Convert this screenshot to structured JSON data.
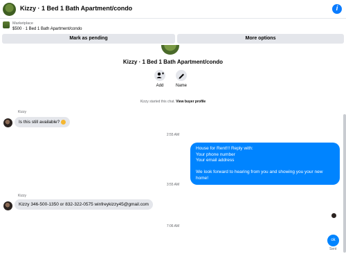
{
  "header": {
    "title": "Kizzy · 1 Bed 1 Bath Apartment/condo",
    "info_icon": "info-icon"
  },
  "marketplace": {
    "label": "Marketplace",
    "price_title": "$500 · 1 Bed 1 Bath Apartment/condo",
    "mark_pending": "Mark as pending",
    "more_options": "More options"
  },
  "chat": {
    "title": "Kizzy · 1 Bed 1 Bath Apartment/condo",
    "actions": {
      "add": "Add",
      "name": "Name"
    },
    "started_text": "Kizzy started this chat.",
    "view_profile": "View buyer profile",
    "sender": "Kizzy",
    "messages": {
      "m1": "Is this still available?",
      "t1": "2:55 AM",
      "out1": [
        "House for Rent!!! Reply with:",
        "Your phone number",
        "Your email address",
        "",
        "We look forward to hearing from you and showing you your new home!"
      ],
      "t2": "3:55 AM",
      "m2": "Kizzy 346-500-1350 or 832-322-0575 winfreykizzy45@gmail.com",
      "t3": "7:06 AM",
      "out2": "ok",
      "sent": "Sent"
    }
  },
  "colors": {
    "accent": "#0084ff",
    "bubble_in": "#e4e6eb",
    "button_bg": "#e4e6eb"
  }
}
